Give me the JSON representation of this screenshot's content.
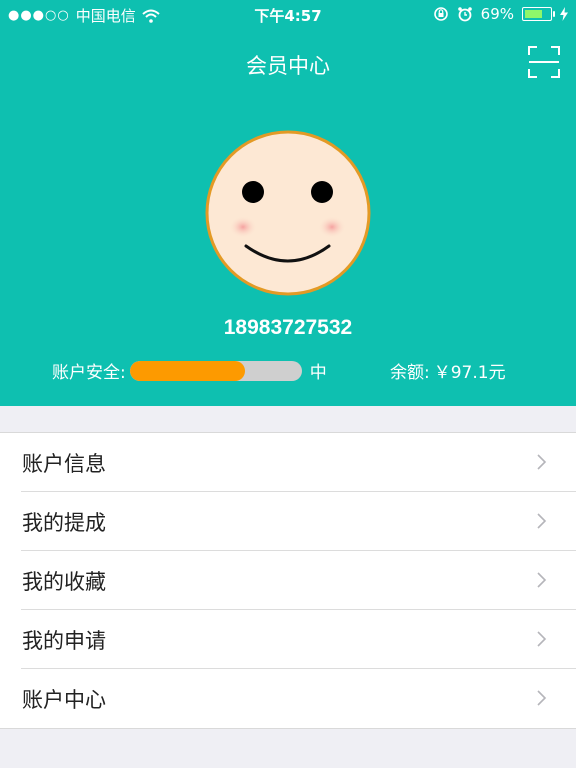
{
  "status_bar": {
    "carrier": "中国电信",
    "time": "下午4:57",
    "battery": "69%"
  },
  "header": {
    "title": "会员中心",
    "phone": "18983727532",
    "security_label": "账户安全:",
    "security_level": "中",
    "security_progress": 0.67,
    "balance_label": "余额:",
    "balance_value": "￥97.1元"
  },
  "icons": {
    "scan": "scan-icon",
    "avatar": "smiley-avatar",
    "chevron": "chevron-right-icon",
    "wifi": "wifi-icon",
    "battery": "battery-icon"
  },
  "colors": {
    "header_bg": "#0ec0b0",
    "progress_fill": "#fd9a00",
    "progress_track": "#cfcfcf",
    "page_bg": "#efeff4"
  },
  "menu": {
    "items": [
      {
        "label": "账户信息"
      },
      {
        "label": "我的提成"
      },
      {
        "label": "我的收藏"
      },
      {
        "label": "我的申请"
      },
      {
        "label": "账户中心"
      }
    ]
  }
}
